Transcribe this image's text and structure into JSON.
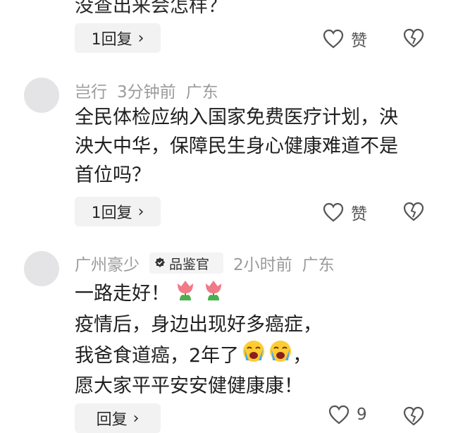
{
  "top_comment": {
    "cut_text": "没查出来会怎样？",
    "reply_label": "1回复",
    "like_label": "赞"
  },
  "comments": [
    {
      "username": "岂行",
      "time": "3分钟前",
      "region": "广东",
      "lines": [
        "全民体检应纳入国家免费医疗计划，泱",
        "泱大中华，保障民生身心健康难道不是",
        "首位吗？"
      ],
      "reply_label": "1回复",
      "like_label": "赞"
    },
    {
      "username": "广州豪少",
      "badge": "品鉴官",
      "time": "2小时前",
      "region": "广东",
      "lines": [
        "一路走好！",
        "疫情后，身边出现好多癌症，",
        "我爸食道癌，2年了",
        "，",
        "愿大家平平安安健健康康！"
      ],
      "reply_label": "回复",
      "like_count": "9"
    }
  ],
  "colors": {
    "meta": "#9b9b9b",
    "button_bg": "#f2f2f2",
    "avatar": "#e4e4e6"
  }
}
